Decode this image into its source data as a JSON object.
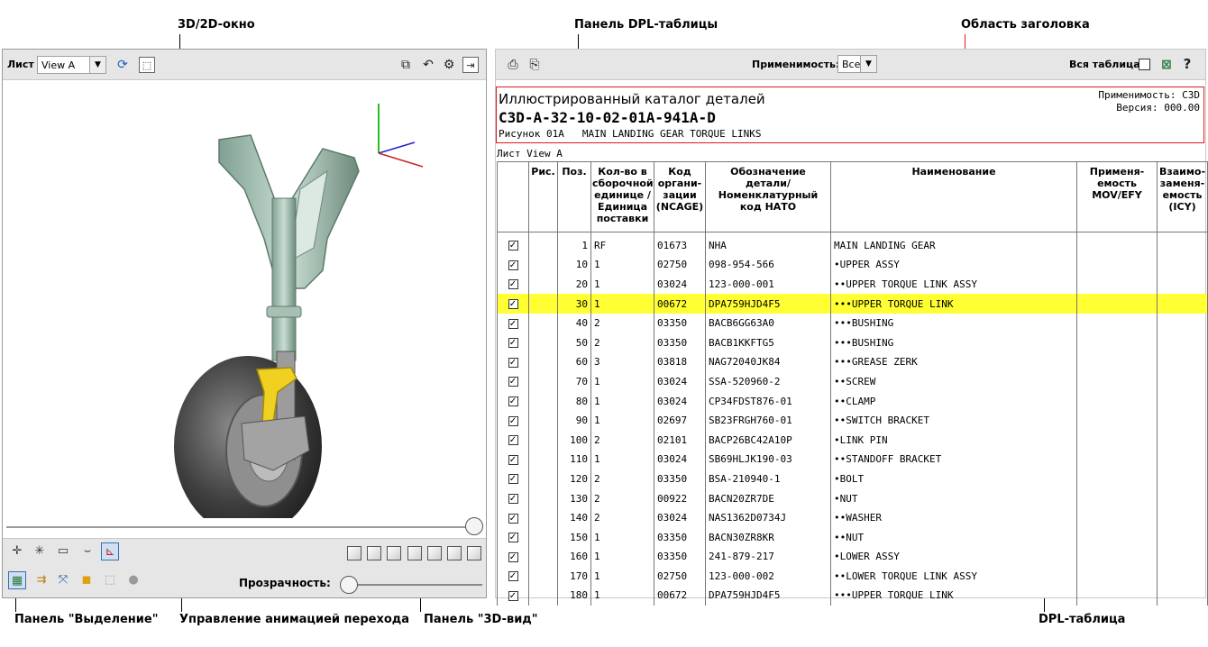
{
  "callouts": {
    "viewer_window": "3D/2D-окно",
    "dpl_toolbar": "Панель DPL-таблицы",
    "header_area": "Область заголовка",
    "selection_panel": "Панель \"Выделение\"",
    "animation_control": "Управление анимацией перехода",
    "view3d_panel": "Панель \"3D-вид\"",
    "dpl_table": "DPL-таблица"
  },
  "viewer": {
    "sheet_label": "Лист",
    "sheet_value": "View A",
    "transparency_label": "Прозрачность:",
    "transparency_value": 0,
    "animation_progress": 1.0
  },
  "dpl_toolbar": {
    "applicability_label": "Применимость:",
    "applicability_value": "Все",
    "whole_table_label": "Вся таблица",
    "help_label": "?"
  },
  "header": {
    "title": "Иллюстрированный каталог деталей",
    "code": "C3D-A-32-10-02-01A-941A-D",
    "figure_label": "Рисунок 01A",
    "figure_title": "MAIN LANDING GEAR TORQUE LINKS",
    "applicability": "Применимость: C3D",
    "version": "Версия: 000.00"
  },
  "sheet_label": "Лист View A",
  "table": {
    "columns": {
      "fig": "Рис.",
      "item": "Поз.",
      "qty": "Кол-во в сборочной единице /Единица поставки",
      "ncage": "Код органи- зации (NCAGE)",
      "part": "Обозначение детали/ Номенклатурный код НАТО",
      "name": "Наименование",
      "mov": "Применя- емость MOV/EFY",
      "icy": "Взаимо- заменя- емость (ICY)"
    },
    "rows": [
      {
        "item": "1",
        "qty": "RF",
        "ncage": "01673",
        "part": "NHA",
        "name": "MAIN LANDING GEAR",
        "hl": false
      },
      {
        "item": "10",
        "qty": "1",
        "ncage": "02750",
        "part": "098-954-566",
        "name": "•UPPER ASSY",
        "hl": false
      },
      {
        "item": "20",
        "qty": "1",
        "ncage": "03024",
        "part": "123-000-001",
        "name": "••UPPER TORQUE LINK ASSY",
        "hl": false
      },
      {
        "item": "30",
        "qty": "1",
        "ncage": " 00672",
        "part": "DPA759HJD4F5",
        "name": "•••UPPER TORQUE LINK",
        "hl": true
      },
      {
        "item": "40",
        "qty": "2",
        "ncage": "03350",
        "part": "BACB6GG63A0",
        "name": "•••BUSHING",
        "hl": false
      },
      {
        "item": "50",
        "qty": "2",
        "ncage": "03350",
        "part": "BACB1KKFTG5",
        "name": "•••BUSHING",
        "hl": false
      },
      {
        "item": "60",
        "qty": "3",
        "ncage": "03818",
        "part": "NAG72040JK84",
        "name": "•••GREASE ZERK",
        "hl": false
      },
      {
        "item": "70",
        "qty": "1",
        "ncage": "03024",
        "part": "SSA-520960-2",
        "name": "••SCREW",
        "hl": false
      },
      {
        "item": "80",
        "qty": "1",
        "ncage": "03024",
        "part": "CP34FDST876-01",
        "name": "••CLAMP",
        "hl": false
      },
      {
        "item": "90",
        "qty": "1",
        "ncage": "02697",
        "part": "SB23FRGH760-01",
        "name": "••SWITCH BRACKET",
        "hl": false
      },
      {
        "item": "100",
        "qty": "2",
        "ncage": "02101",
        "part": "BACP26BC42A10P",
        "name": "•LINK PIN",
        "hl": false
      },
      {
        "item": "110",
        "qty": "1",
        "ncage": "03024",
        "part": "SB69HLJK190-03",
        "name": "••STANDOFF BRACKET",
        "hl": false
      },
      {
        "item": "120",
        "qty": "2",
        "ncage": "03350",
        "part": "BSA-210940-1",
        "name": "•BOLT",
        "hl": false
      },
      {
        "item": "130",
        "qty": "2",
        "ncage": "00922",
        "part": "BACN20ZR7DE",
        "name": "•NUT",
        "hl": false
      },
      {
        "item": "140",
        "qty": "2",
        "ncage": "03024",
        "part": "NAS1362D0734J",
        "name": "••WASHER",
        "hl": false
      },
      {
        "item": "150",
        "qty": "1",
        "ncage": "03350",
        "part": "BACN30ZR8KR",
        "name": "••NUT",
        "hl": false
      },
      {
        "item": "160",
        "qty": "1",
        "ncage": "03350",
        "part": "241-879-217",
        "name": "•LOWER ASSY",
        "hl": false
      },
      {
        "item": "170",
        "qty": "1",
        "ncage": "02750",
        "part": "123-000-002",
        "name": "••LOWER TORQUE LINK ASSY",
        "hl": false
      },
      {
        "item": "180",
        "qty": "1",
        "ncage": "00672",
        "part": "DPA759HJD4F5",
        "name": "•••UPPER TORQUE LINK",
        "hl": false
      }
    ]
  },
  "icons": {
    "viewer_toolbar_left": [
      "refresh-icon",
      "select-area-icon"
    ],
    "viewer_toolbar_right": [
      "layers-icon",
      "rotate-cursor-icon",
      "gear-icon",
      "exit-panel-icon"
    ],
    "dpl_toolbar_left": [
      "print-icon",
      "print-preview-icon"
    ],
    "dpl_toolbar_right": [
      "excel-icon"
    ],
    "selection_row1": [
      "crosshair-icon",
      "star-cross-icon",
      "rectangle-select-icon",
      "surface-select-icon",
      "axis-icon"
    ],
    "selection_row2": [
      "model-select-icon",
      "move-icon",
      "fit-icon",
      "cube-color-icon",
      "dashed-cube-icon",
      "sphere-icon"
    ],
    "view3d": [
      "view-front-icon",
      "view-back-icon",
      "view-left-icon",
      "view-right-icon",
      "view-top-icon",
      "view-bottom-icon",
      "view-iso-icon"
    ]
  },
  "colors": {
    "highlight_row": "#ffff33",
    "header_frame": "#e01818",
    "toolbar_bg": "#e6e6e6"
  }
}
